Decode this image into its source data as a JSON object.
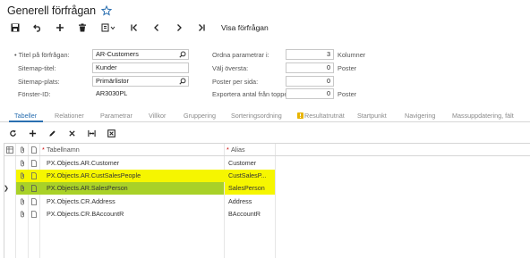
{
  "header": {
    "title": "Generell förfrågan"
  },
  "toolbar": {
    "view_query_label": "Visa förfrågan"
  },
  "form": {
    "left": [
      {
        "label": "Titel på förfrågan:",
        "value": "AR-Customers",
        "required": "•"
      },
      {
        "label": "Sitemap-titel:",
        "value": "Kunder"
      },
      {
        "label": "Sitemap-plats:",
        "value": "Primärlistor"
      },
      {
        "label": "Fönster-ID:",
        "value": "AR3030PL"
      }
    ],
    "right": [
      {
        "label": "Ordna parametrar i:",
        "value": "3",
        "suffix": "Kolumner"
      },
      {
        "label": "Välj översta:",
        "value": "0",
        "suffix": "Poster"
      },
      {
        "label": "Poster per sida:",
        "value": "0"
      },
      {
        "label": "Exportera antal från toppen:",
        "value": "0",
        "suffix": "Poster"
      }
    ]
  },
  "tabs": [
    {
      "label": "Tabeller",
      "active": true
    },
    {
      "label": "Relationer"
    },
    {
      "label": "Parametrar"
    },
    {
      "label": "Villkor"
    },
    {
      "label": "Gruppering"
    },
    {
      "label": "Sorteringsordning"
    },
    {
      "label": "Resultatrutnät",
      "warning": true
    },
    {
      "label": "Startpunkt"
    },
    {
      "label": "Navigering"
    },
    {
      "label": "Massuppdatering, fält"
    }
  ],
  "grid": {
    "headers": {
      "table_name": "Tabellnamn",
      "alias": "Alias",
      "required": "*"
    },
    "rows": [
      {
        "table_name": "PX.Objects.AR.Customer",
        "alias": "Customer",
        "highlight": "none"
      },
      {
        "table_name": "PX.Objects.AR.CustSalesPeople",
        "alias": "CustSalesP...",
        "highlight": "yellow"
      },
      {
        "table_name": "PX.Objects.AR.SalesPerson",
        "alias": "SalesPerson",
        "highlight": "green",
        "current": true
      },
      {
        "table_name": "PX.Objects.CR.Address",
        "alias": "Address",
        "highlight": "none"
      },
      {
        "table_name": "PX.Objects.CR.BAccountR",
        "alias": "BAccountR",
        "highlight": "none"
      }
    ]
  },
  "colors": {
    "accent": "#2a6fb0",
    "highlight_yellow": "#f6f600",
    "highlight_green": "#a9d128"
  }
}
